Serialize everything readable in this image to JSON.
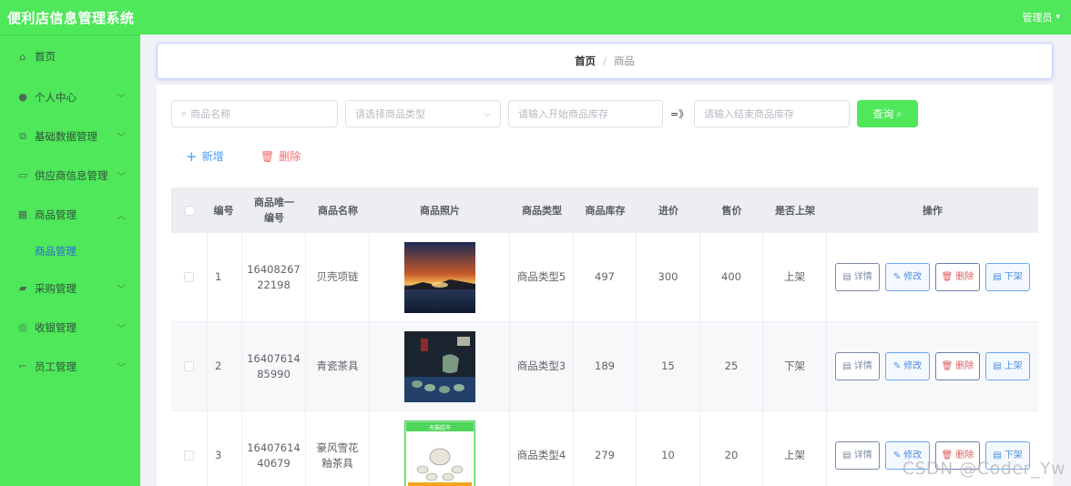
{
  "app": {
    "title": "便利店信息管理系统",
    "user": "管理员"
  },
  "sidebar": {
    "items": [
      {
        "label": "首页",
        "icon": "home-icon",
        "glyph": "⌂"
      },
      {
        "label": "个人中心",
        "icon": "user-icon",
        "glyph": "●",
        "chevron": "﹀"
      },
      {
        "label": "基础数据管理",
        "icon": "copy-icon",
        "glyph": "⧉",
        "chevron": "﹀"
      },
      {
        "label": "供应商信息管理",
        "icon": "chat-icon",
        "glyph": "▭",
        "chevron": "﹀"
      },
      {
        "label": "商品管理",
        "icon": "grid-icon",
        "glyph": "▦",
        "chevron": "︿"
      },
      {
        "label": "采购管理",
        "icon": "folder-icon",
        "glyph": "▰",
        "chevron": "﹀"
      },
      {
        "label": "收银管理",
        "icon": "mic-icon",
        "glyph": "◎",
        "chevron": "﹀"
      },
      {
        "label": "员工管理",
        "icon": "crop-icon",
        "glyph": "⌐",
        "chevron": "﹀"
      }
    ],
    "submenu": {
      "label": "商品管理"
    }
  },
  "breadcrumb": {
    "home": "首页",
    "sep": "/",
    "current": "商品"
  },
  "search": {
    "name_placeholder": "商品名称",
    "type_placeholder": "请选择商品类型",
    "stock_start_placeholder": "请输入开始商品库存",
    "arrow": "=》",
    "stock_end_placeholder": "请输入结束商品库存",
    "query_label": "查询"
  },
  "actions": {
    "add_label": "新增",
    "delete_label": "删除"
  },
  "table": {
    "headers": {
      "id": "编号",
      "uid_1": "商品唯一",
      "uid_2": "编号",
      "name": "商品名称",
      "photo": "商品照片",
      "type": "商品类型",
      "stock": "商品库存",
      "in_price": "进价",
      "out_price": "售价",
      "shelf": "是否上架",
      "ops": "操作"
    },
    "rows": [
      {
        "id": "1",
        "uid_1": "16408267",
        "uid_2": "22198",
        "name_1": "贝壳项链",
        "name_2": "",
        "type": "商品类型5",
        "stock": "497",
        "in_price": "300",
        "out_price": "400",
        "shelf": "上架",
        "shelf_btn": "下架"
      },
      {
        "id": "2",
        "uid_1": "16407614",
        "uid_2": "85990",
        "name_1": "青瓷茶具",
        "name_2": "",
        "type": "商品类型3",
        "stock": "189",
        "in_price": "15",
        "out_price": "25",
        "shelf": "下架",
        "shelf_btn": "上架"
      },
      {
        "id": "3",
        "uid_1": "16407614",
        "uid_2": "40679",
        "name_1": "豪风雪花",
        "name_2": "釉茶具",
        "type": "商品类型4",
        "stock": "279",
        "in_price": "10",
        "out_price": "20",
        "shelf": "上架",
        "shelf_btn": "下架"
      }
    ],
    "ops": {
      "detail": "详情",
      "edit": "修改",
      "delete": "删除"
    },
    "thumb_label": "天猫超市"
  },
  "watermark": "CSDN @Coder_Yw",
  "colors": {
    "brand": "#4ee85a",
    "primary": "#409eff",
    "danger": "#f56c6c"
  }
}
